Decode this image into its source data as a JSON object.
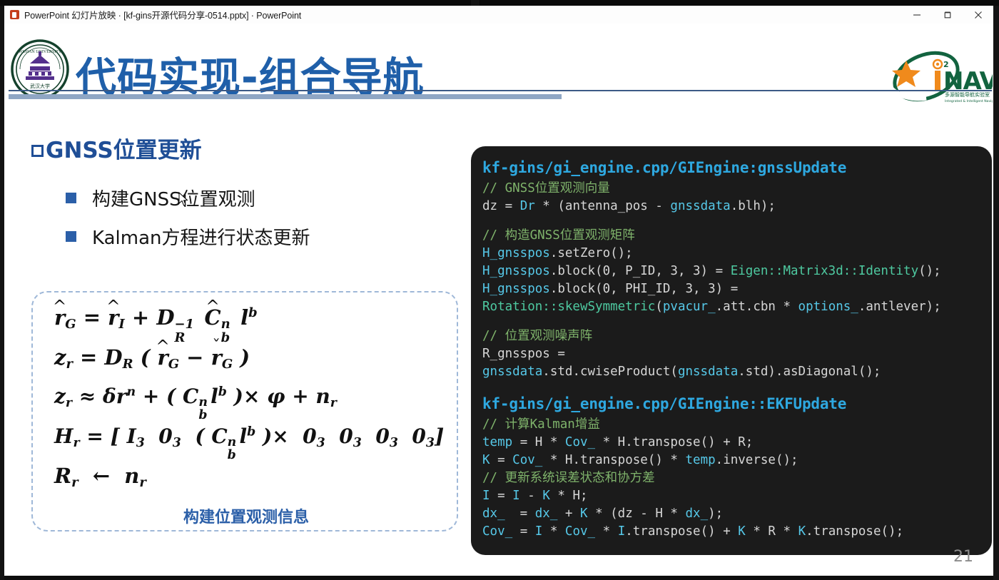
{
  "window": {
    "title": "PowerPoint 幻灯片放映 · [kf-gins开源代码分享-0514.pptx] · PowerPoint",
    "app_icon": "powerpoint-icon",
    "controls": [
      {
        "name": "minimize-button",
        "glyph": "minimize-icon"
      },
      {
        "name": "restore-button",
        "glyph": "restore-icon"
      },
      {
        "name": "close-button",
        "glyph": "close-icon"
      }
    ]
  },
  "slide": {
    "title": "代码实现-组合导航",
    "logo_left": "wuhan-university-logo",
    "logo_right": "inav-logo",
    "page_number": "21",
    "heading": "GNSS位置更新",
    "bullets": [
      "构建GNSS位置观测",
      "Kalman方程进行状态更新"
    ],
    "formula_caption": "构建位置观测信息",
    "formulas": [
      "r̂_G = r̂_I + D_R^{-1} Ĉ_b^n l^b",
      "z_r = D_R ( r̂_G − ř_G )",
      "z_r ≈ δr^n + ( C_b^n l^b ) × φ + n_r",
      "H_r = [ I_3  0_3  ( C_b^n l^b ) ×  0_3  0_3  0_3  0_3 ]",
      "R_r ← n_r"
    ]
  },
  "code_panel": {
    "lines": [
      {
        "type": "hdr",
        "text": "kf-gins/gi_engine.cpp/GIEngine:gnssUpdate"
      },
      {
        "type": "cmt",
        "text": "// GNSS位置观测向量"
      },
      {
        "type": "code",
        "text": "dz = Dr * (antenna_pos - gnssdata.blh);"
      },
      {
        "type": "blank",
        "text": ""
      },
      {
        "type": "cmt",
        "text": "// 构造GNSS位置观测矩阵"
      },
      {
        "type": "code",
        "text": "H_gnsspos.setZero();"
      },
      {
        "type": "code",
        "text": "H_gnsspos.block(0, P_ID, 3, 3) = Eigen::Matrix3d::Identity();"
      },
      {
        "type": "code",
        "text": "H_gnsspos.block(0, PHI_ID, 3, 3) ="
      },
      {
        "type": "code",
        "text": "Rotation::skewSymmetric(pvacur_.att.cbn * options_.antlever);"
      },
      {
        "type": "blank",
        "text": ""
      },
      {
        "type": "cmt",
        "text": "// 位置观测噪声阵"
      },
      {
        "type": "code",
        "text": "R_gnsspos ="
      },
      {
        "type": "code",
        "text": "gnssdata.std.cwiseProduct(gnssdata.std).asDiagonal();"
      },
      {
        "type": "blank",
        "text": ""
      },
      {
        "type": "hdr",
        "text": "kf-gins/gi_engine.cpp/GIEngine::EKFUpdate"
      },
      {
        "type": "cmt",
        "text": "// 计算Kalman增益"
      },
      {
        "type": "code",
        "text": "temp = H * Cov_ * H.transpose() + R;"
      },
      {
        "type": "code",
        "text": "K = Cov_ * H.transpose() * temp.inverse();"
      },
      {
        "type": "cmt",
        "text": "// 更新系统误差状态和协方差"
      },
      {
        "type": "code",
        "text": "I = I - K * H;"
      },
      {
        "type": "code",
        "text": "dx_  = dx_ + K * (dz - H * dx_);"
      },
      {
        "type": "code",
        "text": "Cov_ = I * Cov_ * I.transpose() + K * R * K.transpose();"
      }
    ]
  },
  "colors": {
    "title_blue": "#1f5fa9",
    "heading_blue": "#1f4e96",
    "rule_dark": "#3c5a86",
    "rule_light": "#8fa6c4",
    "code_bg": "#1b1b1b",
    "code_header": "#2ea8e0",
    "code_comment": "#7fb36b",
    "code_text": "#d6d6d6",
    "code_identifier": "#56c8e8",
    "code_type": "#4ec9a0",
    "page_number": "#8c8c8c"
  }
}
